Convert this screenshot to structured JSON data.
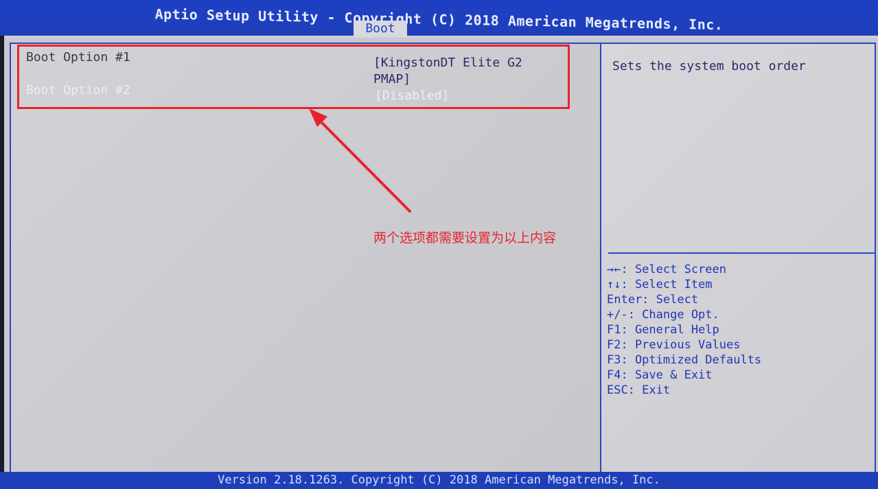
{
  "header": {
    "title": "Aptio Setup Utility - Copyright (C) 2018 American Megatrends, Inc.",
    "active_tab": "Boot"
  },
  "boot_options": [
    {
      "label": "Boot Option #1",
      "value": "[KingstonDT Elite G2 PMAP]"
    },
    {
      "label": "Boot Option #2",
      "value": "[Disabled]"
    }
  ],
  "help_panel": {
    "description": "Sets the system boot order",
    "keys": [
      "→←: Select Screen",
      "↑↓: Select Item",
      "Enter: Select",
      "+/-: Change Opt.",
      "F1: General Help",
      "F2: Previous Values",
      "F3: Optimized Defaults",
      "F4: Save & Exit",
      "ESC: Exit"
    ]
  },
  "annotation": {
    "text": "两个选项都需要设置为以上内容",
    "color": "#e6242c"
  },
  "footer": {
    "text": "Version 2.18.1263. Copyright (C) 2018 American Megatrends, Inc."
  },
  "colors": {
    "header_blue": "#1f3fb9",
    "panel_gray": "#cfced3",
    "border_blue": "#2a46c0",
    "key_text": "#2236b5"
  }
}
